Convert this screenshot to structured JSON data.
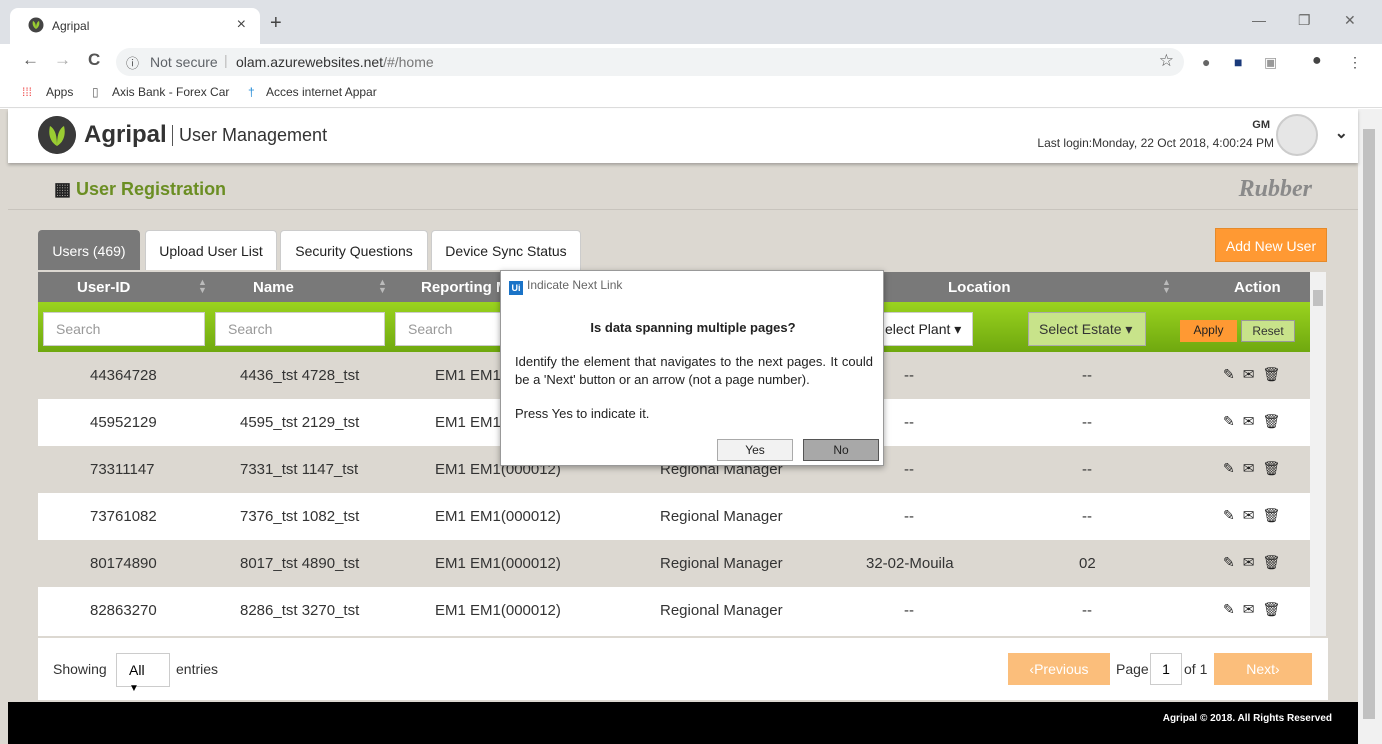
{
  "browser": {
    "tab_title": "Agripal",
    "tab_close": "×",
    "new_tab": "+",
    "window_controls": [
      "—",
      "❐",
      "✕"
    ],
    "nav": [
      "←",
      "→",
      "C"
    ],
    "not_secure": "Not secure",
    "url_host": "olam.azurewebsites.net",
    "url_path": "/#/home",
    "bookmarks": [
      "Apps",
      "Axis Bank - Forex Car",
      "Acces internet Appar"
    ]
  },
  "app": {
    "brand": "Agripal",
    "module": "User Management",
    "user_initials": "GM",
    "last_login": "Last login:Monday, 22 Oct 2018, 4:00:24 PM",
    "section_title": "User Registration",
    "commodity": "Rubber"
  },
  "tabs": [
    {
      "label": "Users (469)"
    },
    {
      "label": "Upload User List"
    },
    {
      "label": "Security Questions"
    },
    {
      "label": "Device Sync Status"
    }
  ],
  "add_new_user": "Add New User",
  "table": {
    "headers": [
      "User-ID",
      "Name",
      "Reporting M",
      "Location",
      "Action"
    ],
    "search_placeholder": "Search",
    "select_plant": "elect Plant ▾",
    "select_estate": "Select Estate ▾",
    "apply": "Apply",
    "reset": "Reset",
    "rows": [
      [
        "44364728",
        "4436_tst 4728_tst",
        "EM1 EM1",
        "",
        "--",
        "--"
      ],
      [
        "45952129",
        "4595_tst 2129_tst",
        "EM1 EM1",
        "",
        "--",
        "--"
      ],
      [
        "73311147",
        "7331_tst 1147_tst",
        "EM1 EM1(000012)",
        "Regional Manager",
        "--",
        "--"
      ],
      [
        "73761082",
        "7376_tst 1082_tst",
        "EM1 EM1(000012)",
        "Regional Manager",
        "--",
        "--"
      ],
      [
        "80174890",
        "8017_tst 4890_tst",
        "EM1 EM1(000012)",
        "Regional Manager",
        "32-02-Mouila",
        "02"
      ],
      [
        "82863270",
        "8286_tst 3270_tst",
        "EM1 EM1(000012)",
        "Regional Manager",
        "--",
        "--"
      ]
    ]
  },
  "pager": {
    "showing": "Showing",
    "entries_value": "All",
    "entries": "entries",
    "previous": "‹Previous",
    "page": "Page",
    "page_num": "1",
    "of": "of 1",
    "next": "Next›"
  },
  "footer": {
    "copyright": "Agripal © 2018. All Rights Reserved"
  },
  "dialog": {
    "title": "Indicate Next Link",
    "question": "Is data spanning multiple pages?",
    "body": "Identify the element that navigates to the next pages. It could be a 'Next' button or an arrow (not a page number).",
    "press": "Press Yes to indicate it.",
    "yes": "Yes",
    "no": "No"
  }
}
